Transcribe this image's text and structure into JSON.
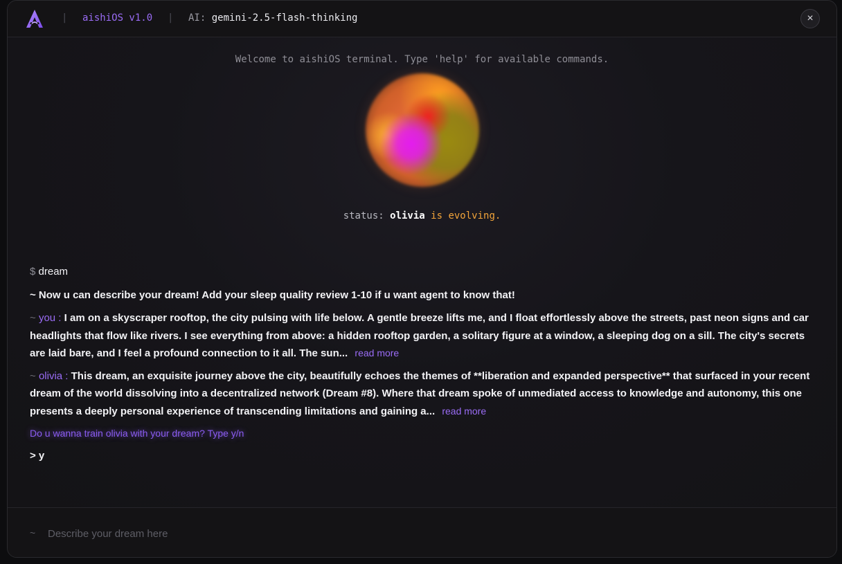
{
  "header": {
    "brand": "aishiOS v1.0",
    "ai_label": "AI:",
    "ai_model": "gemini-2.5-flash-thinking",
    "separator": "|",
    "close_symbol": "×",
    "accent_color": "#9a6cf5"
  },
  "terminal": {
    "welcome": "Welcome to aishiOS terminal. Type 'help' for available commands.",
    "status_prefix": "status:",
    "status_agent": "olivia",
    "status_state": "is evolving.",
    "command_prompt": "$",
    "command": "dream",
    "system_message": "~ Now u can describe your dream! Add your sleep quality review 1-10 if u want agent to know that!",
    "messages": [
      {
        "tilde": "~",
        "speaker": "you :",
        "text": "I am on a skyscraper rooftop, the city pulsing with life below. A gentle breeze lifts me, and I float effortlessly above the streets, past neon signs and car headlights that flow like rivers. I see everything from above: a hidden rooftop garden, a solitary figure at a window, a sleeping dog on a sill. The city's secrets are laid bare, and I feel a profound connection to it all. The sun...",
        "read_more": "read more"
      },
      {
        "tilde": "~",
        "speaker": "olivia :",
        "text": "This dream, an exquisite journey above the city, beautifully echoes the themes of **liberation and expanded perspective** that surfaced in your recent dream of the world dissolving into a decentralized network (Dream #8). Where that dream spoke of unmediated access to knowledge and autonomy, this one presents a deeply personal experience of transcending limitations and gaining a...",
        "read_more": "read more"
      }
    ],
    "question": "Do u wanna train olivia with your dream? Type y/n",
    "answer": "> y"
  },
  "input": {
    "tilde": "~",
    "placeholder": "Describe your dream here",
    "value": ""
  }
}
